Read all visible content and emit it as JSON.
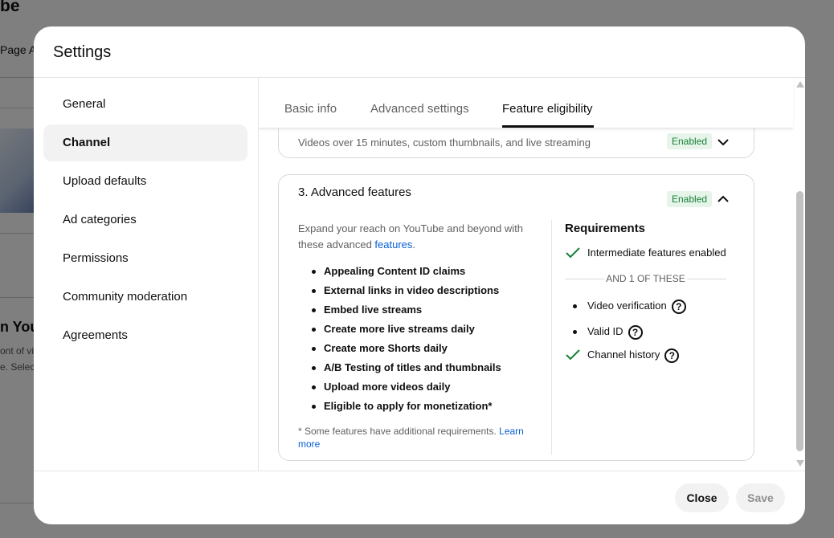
{
  "background": {
    "title": "be",
    "tab_fragment": "Page A",
    "heading_fragment": "n YouT",
    "sub1": "ont of vi",
    "sub2": "e. Selec"
  },
  "dialog": {
    "title": "Settings"
  },
  "sidebar": {
    "items": [
      {
        "label": "General",
        "active": false
      },
      {
        "label": "Channel",
        "active": true
      },
      {
        "label": "Upload defaults",
        "active": false
      },
      {
        "label": "Ad categories",
        "active": false
      },
      {
        "label": "Permissions",
        "active": false
      },
      {
        "label": "Community moderation",
        "active": false
      },
      {
        "label": "Agreements",
        "active": false
      }
    ]
  },
  "tabs": [
    {
      "label": "Basic info",
      "active": false
    },
    {
      "label": "Advanced settings",
      "active": false
    },
    {
      "label": "Feature eligibility",
      "active": true
    }
  ],
  "card_intermediate": {
    "description": "Videos over 15 minutes, custom thumbnails, and live streaming",
    "status": "Enabled",
    "chevron": "chevron-down-icon"
  },
  "card_advanced": {
    "title": "3. Advanced features",
    "status": "Enabled",
    "chevron": "chevron-up-icon",
    "description_prefix": "Expand your reach on YouTube and beyond with these advanced ",
    "description_link": "features",
    "description_suffix": ".",
    "features": [
      "Appealing Content ID claims",
      "External links in video descriptions",
      "Embed live streams",
      "Create more live streams daily",
      "Create more Shorts daily",
      "A/B Testing of titles and thumbnails",
      "Upload more videos daily",
      "Eligible to apply for monetization*"
    ],
    "footnote_text": "* Some features have additional requirements. ",
    "footnote_link": "Learn more",
    "requirements": {
      "title": "Requirements",
      "met": "Intermediate features enabled",
      "divider": "AND 1 OF THESE",
      "options": [
        {
          "label": "Video verification",
          "met": false
        },
        {
          "label": "Valid ID",
          "met": false
        },
        {
          "label": "Channel history",
          "met": true
        }
      ],
      "help_glyph": "?"
    }
  },
  "footer": {
    "close_label": "Close",
    "save_label": "Save"
  },
  "colors": {
    "accent_link": "#065fd4",
    "enabled_bg": "#e6f4ea",
    "enabled_text": "#188038",
    "check": "#188038"
  }
}
